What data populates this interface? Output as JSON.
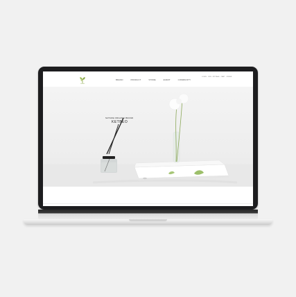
{
  "header": {
    "logo_text": "kenod",
    "nav": [
      "BRAND",
      "PRODUCT",
      "STORE",
      "EVENT",
      "COMMUNITY"
    ],
    "utility": [
      "LOGIN",
      "JOIN",
      "MY PAGE",
      "CART",
      "ORDER"
    ]
  },
  "hero": {
    "tagline": "NATURE ORGANIC BRAND",
    "brand": "KETBEO"
  },
  "colors": {
    "accent": "#8aa84a",
    "bezel": "#1d1d1f",
    "page_background": "#f1f1f1"
  }
}
